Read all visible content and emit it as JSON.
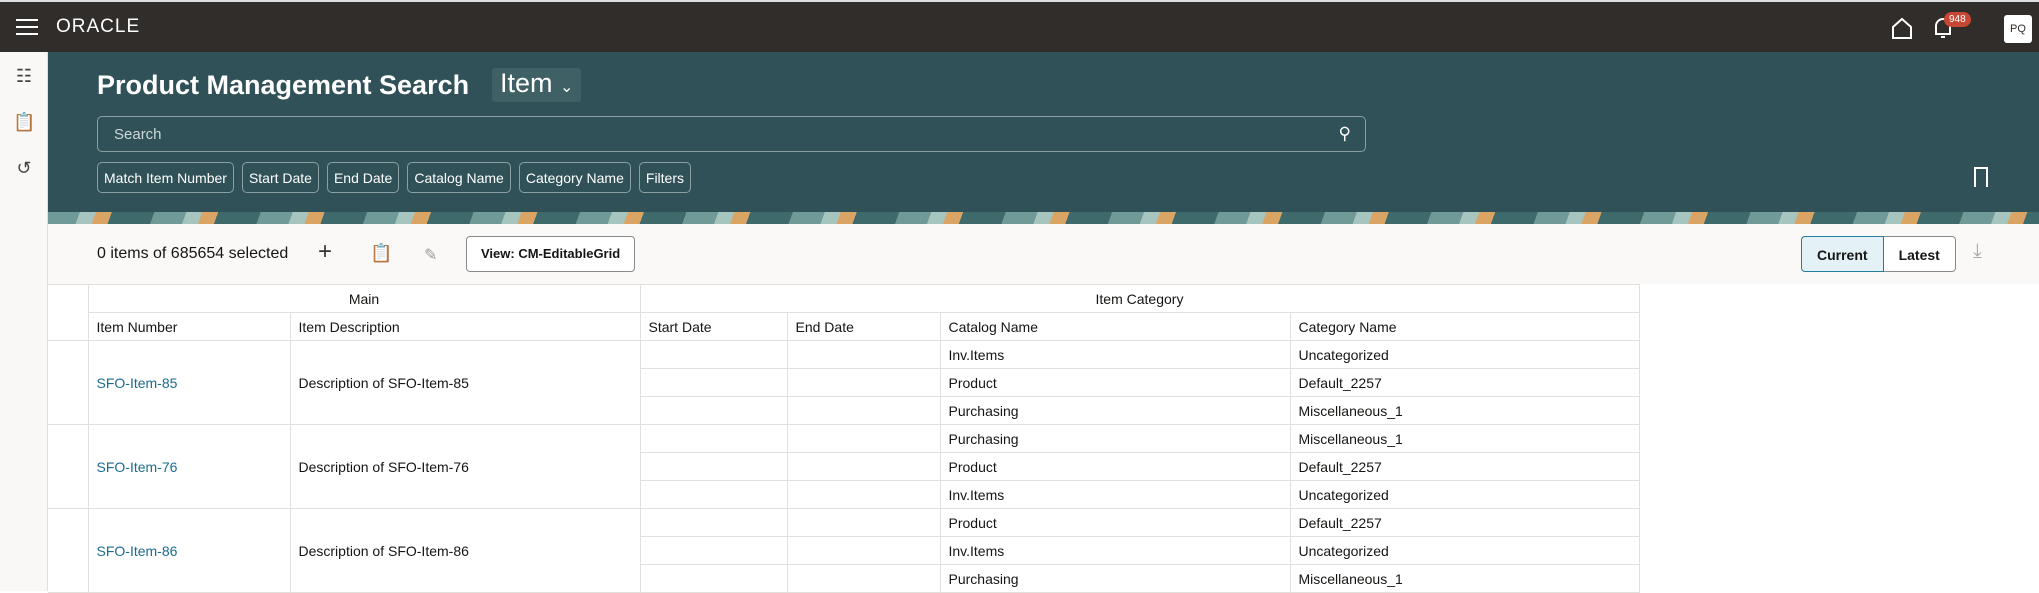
{
  "app": {
    "brand": "ORACLE",
    "notification_count": "948",
    "user_initials": "PQ"
  },
  "header": {
    "title": "Product Management Search",
    "object_type": "Item",
    "search_placeholder": "Search",
    "filter_chips": [
      "Match Item Number",
      "Start Date",
      "End Date",
      "Catalog Name",
      "Category Name",
      "Filters"
    ]
  },
  "toolbar": {
    "selection_text": "0 items of 685654 selected",
    "view_label": "View: CM-EditableGrid",
    "current_label": "Current",
    "latest_label": "Latest"
  },
  "table": {
    "groups": [
      "Main",
      "Item Category"
    ],
    "columns": [
      "Item Number",
      "Item Description",
      "Start Date",
      "End Date",
      "Catalog Name",
      "Category Name"
    ],
    "items": [
      {
        "number": "SFO-Item-85",
        "description": "Description of SFO-Item-85",
        "categories": [
          [
            "Inv.Items",
            "Uncategorized"
          ],
          [
            "Product",
            "Default_2257"
          ],
          [
            "Purchasing",
            "Miscellaneous_1"
          ]
        ]
      },
      {
        "number": "SFO-Item-76",
        "description": "Description of SFO-Item-76",
        "categories": [
          [
            "Purchasing",
            "Miscellaneous_1"
          ],
          [
            "Product",
            "Default_2257"
          ],
          [
            "Inv.Items",
            "Uncategorized"
          ]
        ]
      },
      {
        "number": "SFO-Item-86",
        "description": "Description of SFO-Item-86",
        "categories": [
          [
            "Product",
            "Default_2257"
          ],
          [
            "Inv.Items",
            "Uncategorized"
          ],
          [
            "Purchasing",
            "Miscellaneous_1"
          ]
        ]
      }
    ]
  }
}
